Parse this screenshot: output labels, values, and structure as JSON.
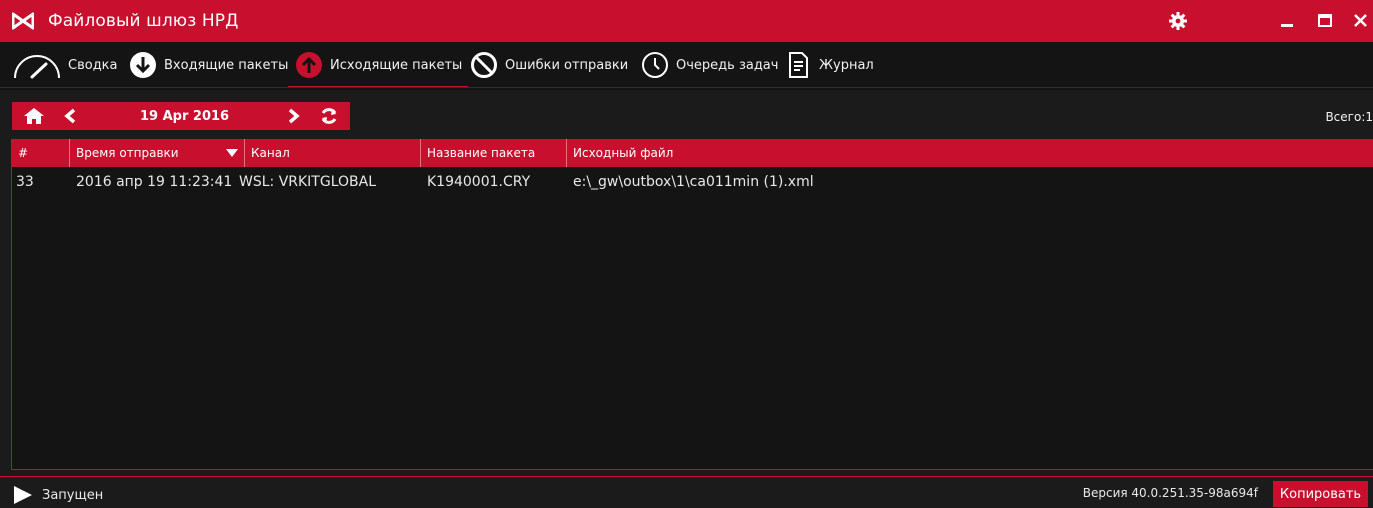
{
  "app": {
    "title": "Файловый шлюз НРД",
    "accent": "#c8102e"
  },
  "window_controls": {
    "settings_icon": "gear-icon",
    "minimize_icon": "minimize-icon",
    "maximize_icon": "maximize-icon",
    "close_icon": "close-icon"
  },
  "tabs": [
    {
      "label": "Сводка",
      "icon": "speedometer-icon",
      "active": false
    },
    {
      "label": "Входящие пакеты",
      "icon": "arrow-down-circle-icon",
      "active": false
    },
    {
      "label": "Исходящие пакеты",
      "icon": "arrow-up-circle-icon",
      "active": true
    },
    {
      "label": "Ошибки отправки",
      "icon": "prohibited-icon",
      "active": false
    },
    {
      "label": "Очередь задач",
      "icon": "clock-icon",
      "active": false
    },
    {
      "label": "Журнал",
      "icon": "document-icon",
      "active": false
    }
  ],
  "datebar": {
    "date": "19 Apr 2016",
    "icons": [
      "home-icon",
      "chevron-left-icon",
      "chevron-right-icon",
      "refresh-icon"
    ]
  },
  "total": "Всего:1",
  "table": {
    "columns": [
      "#",
      "Время отправки",
      "Канал",
      "Название пакета",
      "Исходный файл"
    ],
    "sorted_column": "Время отправки",
    "rows": [
      [
        "33",
        "2016 апр 19 11:23:41",
        "WSL: VRKITGLOBAL",
        "K1940001.CRY",
        "e:\\_gw\\outbox\\1\\ca011min (1).xml"
      ]
    ]
  },
  "footer": {
    "status": "Запущен",
    "version": "Версия 40.0.251.35-98a694f",
    "copy_label": "Копировать"
  }
}
